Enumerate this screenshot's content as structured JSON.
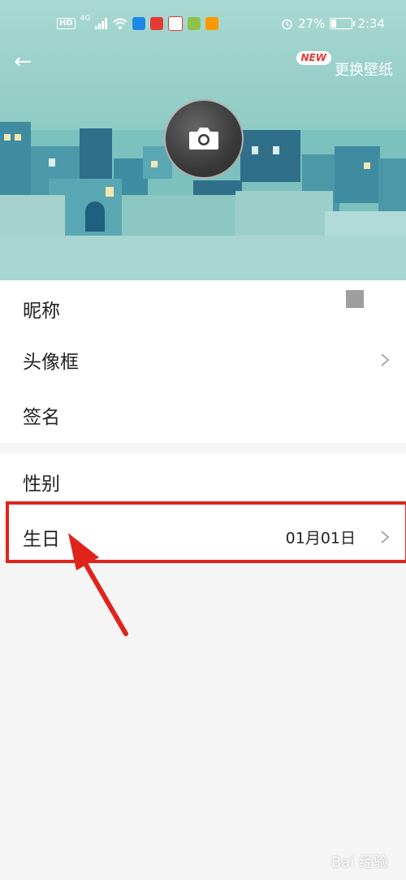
{
  "status_bar": {
    "network": "4G",
    "battery_percent": "27%",
    "battery_level": 0.27,
    "time": "2:34",
    "hd_badge": "HD"
  },
  "header": {
    "back_label": "←",
    "new_badge": "NEW",
    "wallpaper_button": "更换壁纸"
  },
  "profile_rows": [
    {
      "label": "昵称"
    },
    {
      "label": "头像框"
    },
    {
      "label": "签名"
    }
  ],
  "detail_rows": [
    {
      "label": "性别",
      "value": ""
    },
    {
      "label": "生日",
      "value": "01月01日"
    }
  ],
  "watermark": "Bai 经验",
  "colors": {
    "accent_red": "#e0241b",
    "header_teal": "#8fcbc4"
  }
}
